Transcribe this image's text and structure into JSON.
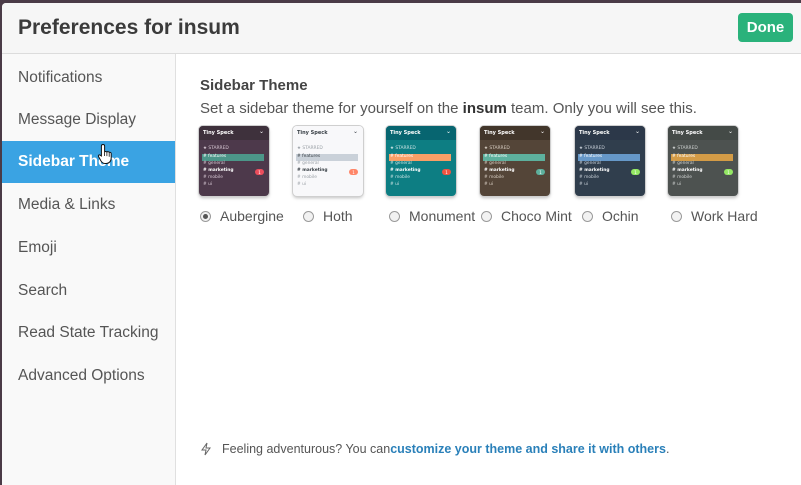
{
  "header": {
    "title": "Preferences for insum",
    "done_label": "Done"
  },
  "sidebar": {
    "items": [
      {
        "label": "Notifications",
        "active": false
      },
      {
        "label": "Message Display",
        "active": false
      },
      {
        "label": "Sidebar Theme",
        "active": true
      },
      {
        "label": "Media & Links",
        "active": false
      },
      {
        "label": "Emoji",
        "active": false
      },
      {
        "label": "Search",
        "active": false
      },
      {
        "label": "Read State Tracking",
        "active": false
      },
      {
        "label": "Advanced Options",
        "active": false
      }
    ]
  },
  "main": {
    "section_title": "Sidebar Theme",
    "desc_before": "Set a sidebar theme for yourself on the ",
    "desc_team": "insum",
    "desc_after": " team. Only you will see this.",
    "preview": {
      "team": "Tiny Speck",
      "starred": "STARRED",
      "channels": [
        "# features",
        "# general",
        "# marketing",
        "# mobile",
        "# ui"
      ],
      "badge": "1"
    },
    "themes": [
      {
        "name": "Aubergine",
        "selected": true,
        "colors": {
          "bg": "#4d394b",
          "head": "#3e313c",
          "text": "#ffffff",
          "active": "#4c9689",
          "badge": "#eb4d5c",
          "dim": "#d8c9d5"
        }
      },
      {
        "name": "Hoth",
        "selected": false,
        "colors": {
          "bg": "#f8f8fa",
          "head": "#f8f8fa",
          "text": "#383f45",
          "active": "#cad1d9",
          "badge": "#ff8669",
          "dim": "#9aa0a6"
        }
      },
      {
        "name": "Monument",
        "selected": false,
        "colors": {
          "bg": "#0d7e83",
          "head": "#076570",
          "text": "#ffffff",
          "active": "#f79f66",
          "badge": "#f15340",
          "dim": "#cce3e4"
        }
      },
      {
        "name": "Choco Mint",
        "selected": false,
        "colors": {
          "bg": "#544538",
          "head": "#42362b",
          "text": "#ffffff",
          "active": "#5db09d",
          "badge": "#5db09d",
          "dim": "#d9cfc4"
        }
      },
      {
        "name": "Ochin",
        "selected": false,
        "colors": {
          "bg": "#303e4d",
          "head": "#2c3849",
          "text": "#ffffff",
          "active": "#6698c8",
          "badge": "#94e864",
          "dim": "#c8d0d8"
        }
      },
      {
        "name": "Work Hard",
        "selected": false,
        "colors": {
          "bg": "#4d5250",
          "head": "#444a47",
          "text": "#ffffff",
          "active": "#d39b46",
          "badge": "#94e864",
          "dim": "#d0d3d2"
        }
      }
    ]
  },
  "footer": {
    "text": "Feeling adventurous? You can ",
    "link": "customize your theme and share it with others",
    "end": "."
  }
}
